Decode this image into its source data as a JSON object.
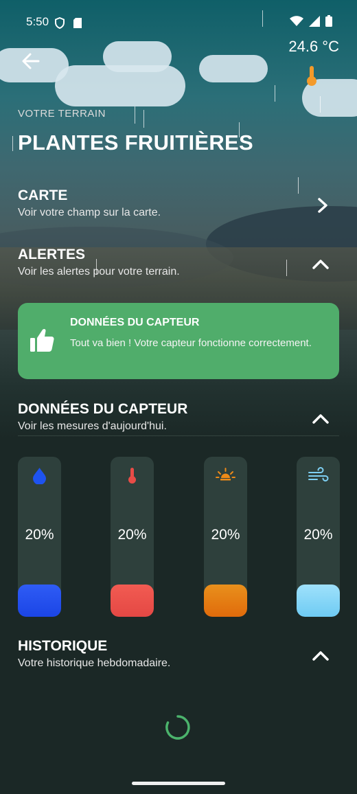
{
  "status": {
    "time": "5:50"
  },
  "weather": {
    "temperature": "24.6 °C"
  },
  "header": {
    "eyebrow": "VOTRE TERRAIN",
    "title": "PLANTES FRUITIÈRES"
  },
  "sections": {
    "carte": {
      "title": "CARTE",
      "subtitle": "Voir votre champ sur la carte."
    },
    "alertes": {
      "title": "ALERTES",
      "subtitle": "Voir les alertes pour votre terrain."
    },
    "donnees": {
      "title": "DONNÉES DU CAPTEUR",
      "subtitle": "Voir les mesures d'aujourd'hui."
    },
    "historique": {
      "title": "HISTORIQUE",
      "subtitle": "Votre historique hebdomadaire."
    }
  },
  "alert_card": {
    "title": "DONNÉES DU CAPTEUR",
    "message": "Tout va bien ! Votre capteur fonctionne correctement.",
    "color": "#50ad6b"
  },
  "gauges": [
    {
      "icon": "water-drop-icon",
      "label": "20%",
      "level": 0.2,
      "color_top": "#2f5cf5",
      "color_bottom": "#1b45e6"
    },
    {
      "icon": "thermometer-icon",
      "label": "20%",
      "level": 0.2,
      "color_top": "#f25b52",
      "color_bottom": "#e44844"
    },
    {
      "icon": "sun-lamp-icon",
      "label": "20%",
      "level": 0.2,
      "color_top": "#e9901c",
      "color_bottom": "#e06b0b"
    },
    {
      "icon": "wind-icon",
      "label": "20%",
      "level": 0.2,
      "color_top": "#9fe1fb",
      "color_bottom": "#6ecbf3"
    }
  ]
}
